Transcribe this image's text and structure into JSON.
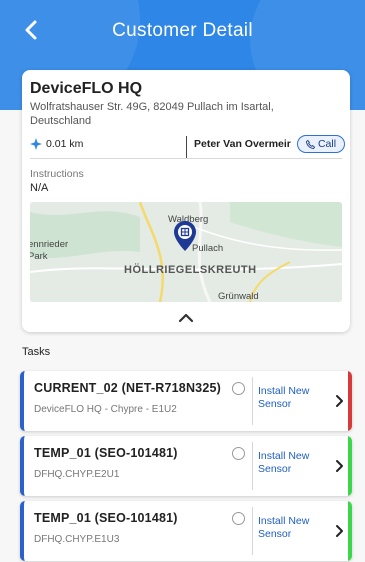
{
  "header": {
    "title": "Customer Detail"
  },
  "customer": {
    "name": "DeviceFLO HQ",
    "address": "Wolfratshauser Str. 49G, 82049 Pullach im Isartal, Deutschland",
    "distance": "0.01 km",
    "contact_name": "Peter Van Overmeir",
    "call_label": "Call",
    "instructions_label": "Instructions",
    "instructions_value": "N/A"
  },
  "map": {
    "labels": [
      "Waldberg",
      "Pullach",
      "Grünwald",
      "ennrieder",
      "Park"
    ],
    "district": "HÖLLRIEGELSKREUTH"
  },
  "tasks_label": "Tasks",
  "tasks": [
    {
      "title": "CURRENT_02 (NET-R718N325)",
      "subtitle": "DeviceFLO HQ - Chypre - E1U2",
      "action": "Install New Sensor",
      "status_color": "#d63a3a"
    },
    {
      "title": "TEMP_01 (SEO-101481)",
      "subtitle": "DFHQ.CHYP.E2U1",
      "action": "Install New Sensor",
      "status_color": "#3bd64a"
    },
    {
      "title": "TEMP_01 (SEO-101481)",
      "subtitle": "DFHQ.CHYP.E1U3",
      "action": "Install New Sensor",
      "status_color": "#3bd64a"
    }
  ],
  "colors": {
    "header": "#2e86e6",
    "accent": "#2a62c9"
  }
}
